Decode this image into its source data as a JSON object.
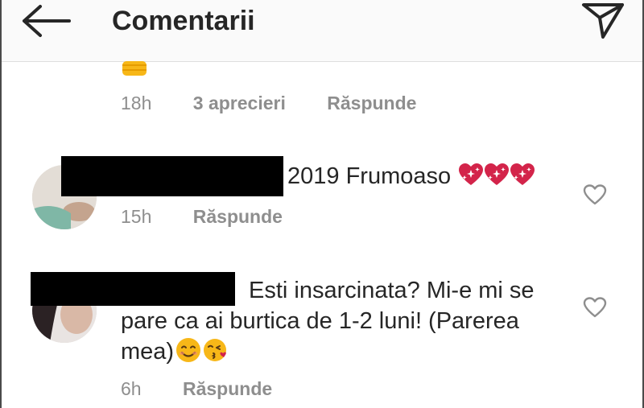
{
  "header": {
    "title": "Comentarii"
  },
  "comments": [
    {
      "time": "18h",
      "likes": "3 aprecieri",
      "reply": "Răspunde"
    },
    {
      "text_visible": "2019 Frumoaso",
      "emoji": "sparkling-hearts",
      "time": "15h",
      "reply": "Răspunde"
    },
    {
      "line1": "Esti insarcinata? Mi-e mi se",
      "line2": "pare ca ai burtica de 1-2 luni! (Parerea",
      "line3": "mea)",
      "emoji": [
        "smiling-face-icon",
        "kissing-face-icon"
      ],
      "time": "6h",
      "reply": "Răspunde"
    }
  ],
  "colors": {
    "header_bg": "#fafafa",
    "meta_gray": "#8e8e8e",
    "text": "#262626",
    "heart_red": "#d3244a",
    "emoji_yellow": "#f7b718"
  }
}
